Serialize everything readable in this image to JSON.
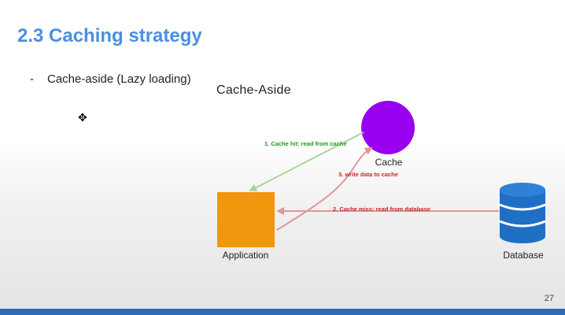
{
  "slide": {
    "title": "2.3 Caching strategy",
    "bullet_marker": "-",
    "bullet_text": "Cache-aside (Lazy loading)",
    "page_number": "27",
    "accent_color": "#4a8fe0",
    "footer_bar_color": "#2f6db3"
  },
  "diagram": {
    "title": "Cache-Aside",
    "nodes": {
      "cache": {
        "label": "Cache",
        "color": "#9900f0",
        "icon": "circle"
      },
      "application": {
        "label": "Application",
        "color": "#f0960f",
        "icon": "square"
      },
      "database": {
        "label": "Database",
        "color": "#1f6fc5",
        "icon": "database-cylinder-icon"
      }
    },
    "edges": {
      "cache_hit": {
        "label": "1. Cache hit: read from cache",
        "color": "#1c9c1c",
        "line_color": "#a8d59a"
      },
      "cache_miss": {
        "label": "2. Cache miss: read from database",
        "color": "#c0282a",
        "line_color": "#e09698"
      },
      "write_cache": {
        "label": "3. write data to cache",
        "color": "#c0282a",
        "line_color": "#e09698"
      }
    }
  }
}
